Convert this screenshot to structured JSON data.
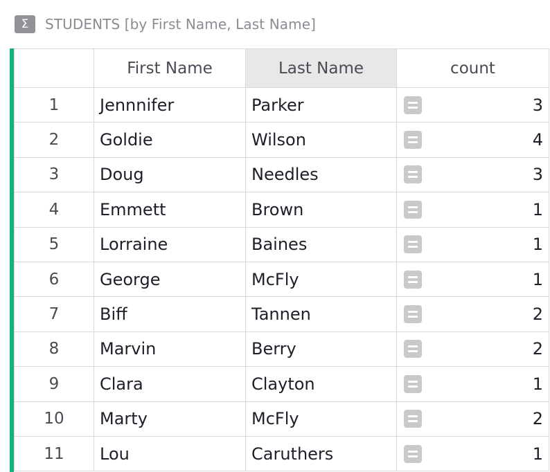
{
  "header": {
    "title_icon": "sigma-icon",
    "title_glyph": "Σ",
    "title": "STUDENTS [by First Name, Last Name]"
  },
  "table": {
    "columns": [
      "",
      "First Name",
      "Last Name",
      "count"
    ],
    "sorted_column": "Last Name",
    "rows": [
      {
        "row": "1",
        "first": "Jennnifer",
        "last": "Parker",
        "count": "3"
      },
      {
        "row": "2",
        "first": "Goldie",
        "last": "Wilson",
        "count": "4"
      },
      {
        "row": "3",
        "first": "Doug",
        "last": "Needles",
        "count": "3"
      },
      {
        "row": "4",
        "first": "Emmett",
        "last": "Brown",
        "count": "1"
      },
      {
        "row": "5",
        "first": "Lorraine",
        "last": "Baines",
        "count": "1"
      },
      {
        "row": "6",
        "first": "George",
        "last": "McFly",
        "count": "1"
      },
      {
        "row": "7",
        "first": "Biff",
        "last": "Tannen",
        "count": "2"
      },
      {
        "row": "8",
        "first": "Marvin",
        "last": "Berry",
        "count": "2"
      },
      {
        "row": "9",
        "first": "Clara",
        "last": "Clayton",
        "count": "1"
      },
      {
        "row": "10",
        "first": "Marty",
        "last": "McFly",
        "count": "2"
      },
      {
        "row": "11",
        "first": "Lou",
        "last": "Caruthers",
        "count": "1"
      }
    ]
  },
  "colors": {
    "accent_stripe": "#16b378",
    "icon_bg": "#929299",
    "formula_icon": "#c9c9c9"
  }
}
